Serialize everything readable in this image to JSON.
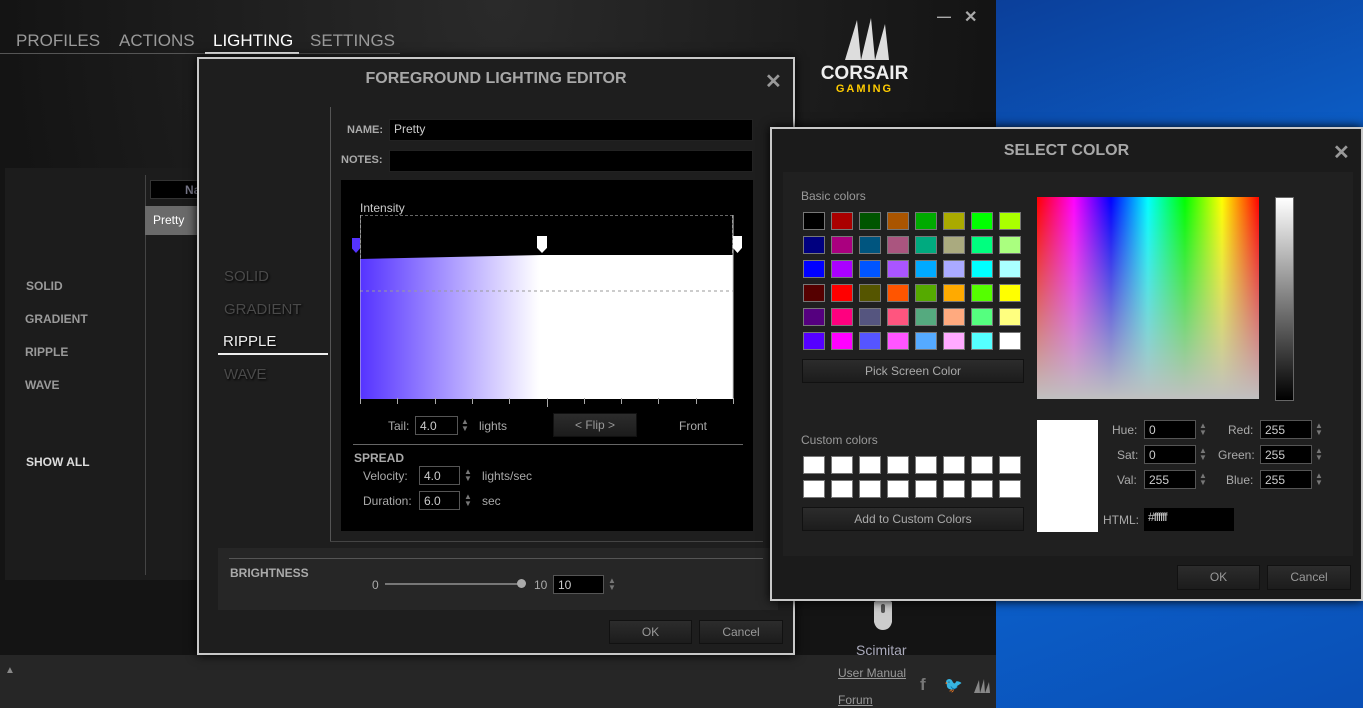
{
  "tabs": [
    {
      "label": "PROFILES"
    },
    {
      "label": "ACTIONS"
    },
    {
      "label": "LIGHTING"
    },
    {
      "label": "SETTINGS"
    }
  ],
  "window": {
    "minimize": "—",
    "close": "✕"
  },
  "brand": {
    "name": "CORSAIR",
    "sub": "GAMING"
  },
  "left_panel": {
    "modes": [
      "SOLID",
      "GRADIENT",
      "RIPPLE",
      "WAVE"
    ],
    "show_all": "SHOW ALL",
    "column_header": "Na",
    "rows": [
      "Pretty"
    ]
  },
  "editor": {
    "title": "FOREGROUND LIGHTING EDITOR",
    "close": "✕",
    "modes": [
      "SOLID",
      "GRADIENT",
      "RIPPLE",
      "WAVE"
    ],
    "active_mode": "RIPPLE",
    "name_label": "NAME:",
    "name_value": "Pretty",
    "notes_label": "NOTES:",
    "notes_value": "",
    "intensity_label": "Intensity",
    "gradient_start_color": "#5533ff",
    "gradient_end_color": "#ffffff",
    "tail_label": "Tail:",
    "tail_value": "4.0",
    "tail_unit": "lights",
    "flip_label": "< Flip >",
    "front_label": "Front",
    "spread_label": "SPREAD",
    "velocity_label": "Velocity:",
    "velocity_value": "4.0",
    "velocity_unit": "lights/sec",
    "duration_label": "Duration:",
    "duration_value": "6.0",
    "duration_unit": "sec",
    "brightness_label": "BRIGHTNESS",
    "brightness_min": "0",
    "brightness_max": "10",
    "brightness_value": "10",
    "brightness_fraction": 1.0,
    "ok": "OK",
    "cancel": "Cancel"
  },
  "select_color": {
    "title": "SELECT COLOR",
    "close": "✕",
    "basic_label": "Basic colors",
    "basic_colors": [
      "#000000",
      "#aa0000",
      "#005500",
      "#aa5500",
      "#00aa00",
      "#aaaa00",
      "#00ff00",
      "#aaff00",
      "#00007f",
      "#aa007f",
      "#00557f",
      "#aa557f",
      "#00aa7f",
      "#aaaa7f",
      "#00ff7f",
      "#aaff7f",
      "#0000ff",
      "#aa00ff",
      "#0055ff",
      "#aa55ff",
      "#00aaff",
      "#aaaaff",
      "#00ffff",
      "#aaffff",
      "#550000",
      "#ff0000",
      "#555500",
      "#ff5500",
      "#55aa00",
      "#ffaa00",
      "#55ff00",
      "#ffff00",
      "#55007f",
      "#ff007f",
      "#55557f",
      "#ff557f",
      "#55aa7f",
      "#ffaa7f",
      "#55ff7f",
      "#ffff7f",
      "#5500ff",
      "#ff00ff",
      "#5555ff",
      "#ff55ff",
      "#55aaff",
      "#ffaaff",
      "#55ffff",
      "#ffffff"
    ],
    "pick_screen": "Pick Screen Color",
    "custom_label": "Custom colors",
    "add_custom": "Add to Custom Colors",
    "hue_label": "Hue:",
    "hue": "0",
    "sat_label": "Sat:",
    "sat": "0",
    "val_label": "Val:",
    "val": "255",
    "red_label": "Red:",
    "red": "255",
    "green_label": "Green:",
    "green": "255",
    "blue_label": "Blue:",
    "blue": "255",
    "html_label": "HTML:",
    "html": "#ffffff",
    "ok": "OK",
    "cancel": "Cancel"
  },
  "footer": {
    "device": "Scimitar",
    "user_manual": "User Manual",
    "forum": "Forum",
    "up_arrow": "▲"
  }
}
